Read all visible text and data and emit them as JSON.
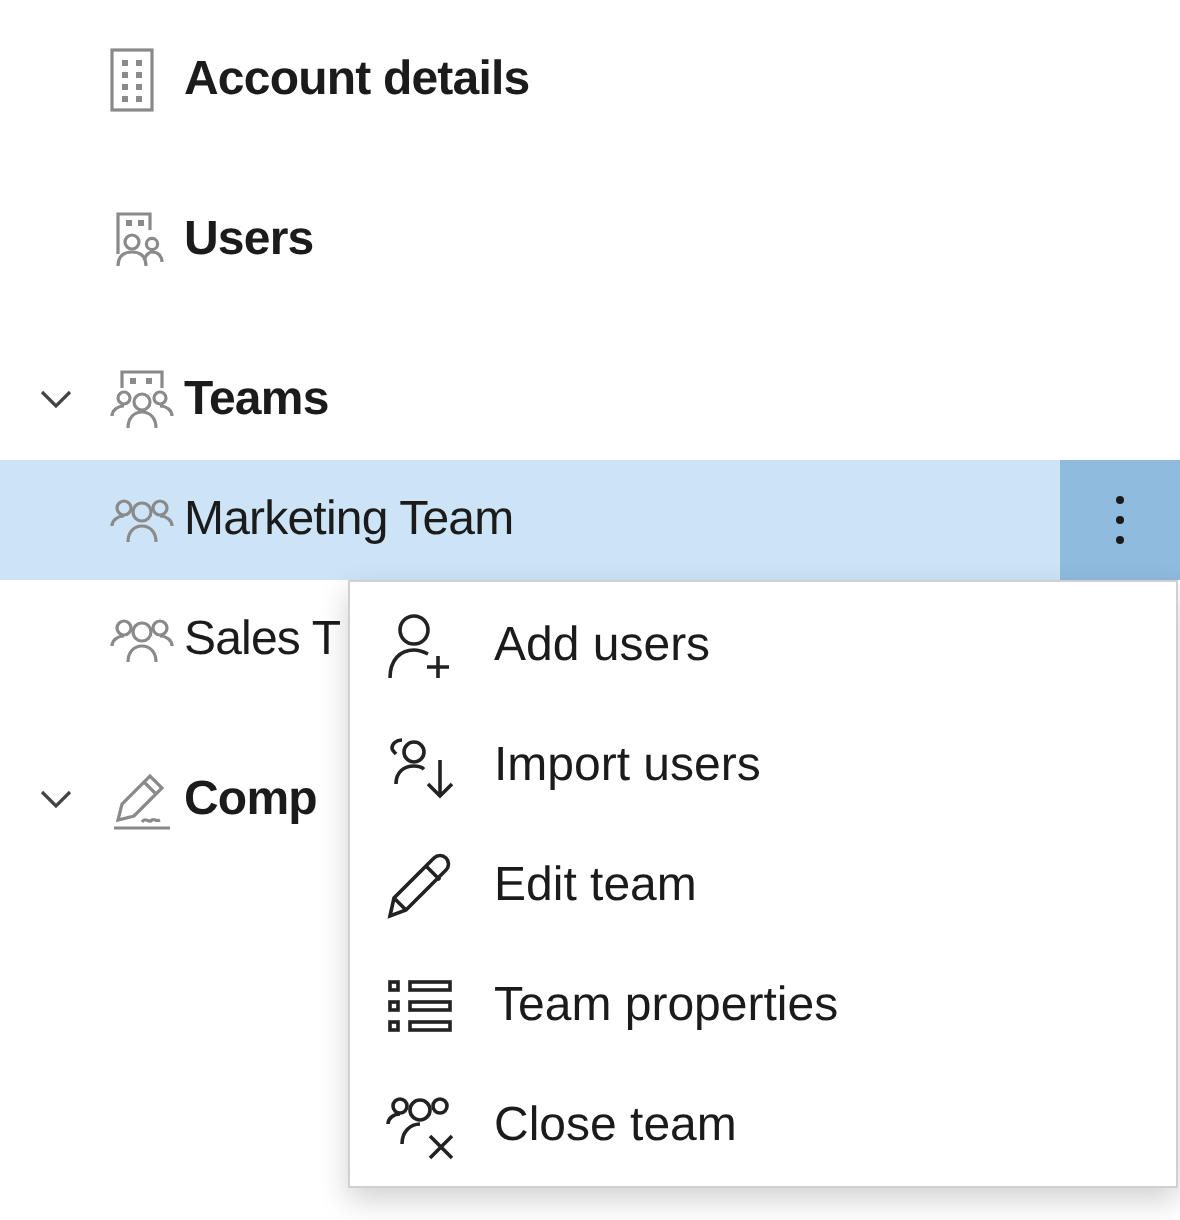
{
  "tree": [
    {
      "label": "Account details"
    },
    {
      "label": "Users"
    },
    {
      "label": "Teams",
      "expanded": true,
      "children": [
        {
          "label": "Marketing Team",
          "selected": true
        },
        {
          "label": "Sales T",
          "selected": false
        }
      ]
    },
    {
      "label": "Comp",
      "expanded": true
    }
  ],
  "context_menu": {
    "items": [
      {
        "label": "Add users"
      },
      {
        "label": "Import users"
      },
      {
        "label": "Edit team"
      },
      {
        "label": "Team properties"
      },
      {
        "label": "Close team"
      }
    ]
  }
}
